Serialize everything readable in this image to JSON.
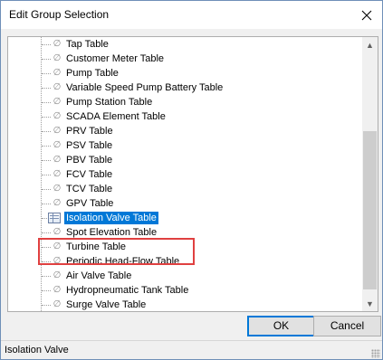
{
  "window": {
    "title": "Edit Group Selection",
    "close_icon": "close-icon"
  },
  "list": {
    "row_icon": "null-set-icon",
    "selected_icon": "table-icon",
    "items": [
      {
        "label": "Tap Table"
      },
      {
        "label": "Customer Meter Table"
      },
      {
        "label": "Pump Table"
      },
      {
        "label": "Variable Speed Pump Battery Table"
      },
      {
        "label": "Pump Station Table"
      },
      {
        "label": "SCADA Element Table"
      },
      {
        "label": "PRV Table"
      },
      {
        "label": "PSV Table"
      },
      {
        "label": "PBV Table"
      },
      {
        "label": "FCV Table"
      },
      {
        "label": "TCV Table"
      },
      {
        "label": "GPV Table"
      },
      {
        "label": "Isolation Valve Table",
        "selected": true
      },
      {
        "label": "Spot Elevation Table"
      },
      {
        "label": "Turbine Table"
      },
      {
        "label": "Periodic Head-Flow Table"
      },
      {
        "label": "Air Valve Table"
      },
      {
        "label": "Hydropneumatic Tank Table"
      },
      {
        "label": "Surge Valve Table"
      }
    ]
  },
  "buttons": {
    "ok": "OK",
    "cancel": "Cancel"
  },
  "status": {
    "text": "Isolation Valve"
  },
  "colors": {
    "selection": "#0078d7",
    "highlight_box": "#e04040"
  }
}
